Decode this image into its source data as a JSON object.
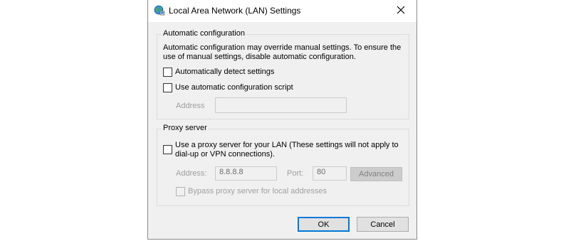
{
  "window": {
    "title": "Local Area Network (LAN) Settings",
    "icon": "globe-network-icon",
    "close_icon": "close-icon"
  },
  "auto_config": {
    "caption": "Automatic configuration",
    "description": "Automatic configuration may override manual settings.  To ensure the use of manual settings, disable automatic configuration.",
    "detect_label": "Automatically detect settings",
    "detect_checked": false,
    "script_label": "Use automatic configuration script",
    "script_checked": false,
    "address_label": "Address",
    "address_value": ""
  },
  "proxy": {
    "caption": "Proxy server",
    "use_proxy_label": "Use a proxy server for your LAN (These settings will not apply to dial-up or VPN connections).",
    "use_proxy_checked": false,
    "address_label": "Address:",
    "address_value": "8.8.8.8",
    "port_label": "Port:",
    "port_value": "80",
    "advanced_label": "Advanced",
    "bypass_label": "Bypass proxy server for local addresses",
    "bypass_checked": false
  },
  "buttons": {
    "ok_label": "OK",
    "cancel_label": "Cancel"
  },
  "colors": {
    "dialog_bg": "#f0f0f0",
    "default_button_border": "#0078d7",
    "disabled_text": "#a0a0a0"
  }
}
